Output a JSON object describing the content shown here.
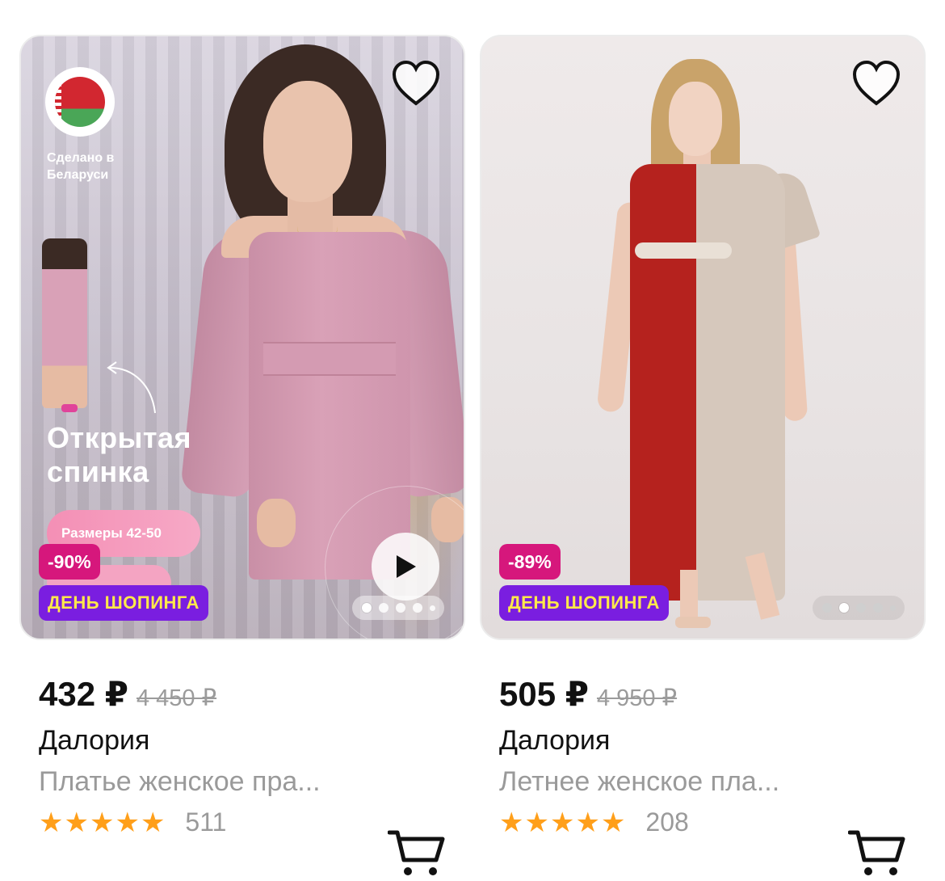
{
  "products": [
    {
      "promo_title": "Открытая спинка",
      "made_in_text": "Сделано в Беларуси",
      "sizes_label": "Размеры 42-50",
      "discount": "-90%",
      "sale_label": "ДЕНЬ ШОПИНГА",
      "price": "432 ₽",
      "old_price": "4 450 ₽",
      "brand": "Далория",
      "title": "Платье женское пра...",
      "rating_stars": 5,
      "reviews": "511",
      "carousel_active": 0,
      "has_video": true
    },
    {
      "discount": "-89%",
      "sale_label": "ДЕНЬ ШОПИНГА",
      "price": "505 ₽",
      "old_price": "4 950 ₽",
      "brand": "Далория",
      "title": "Летнее женское пла...",
      "rating_stars": 5,
      "reviews": "208",
      "carousel_active": 1,
      "has_video": false
    }
  ],
  "colors": {
    "discount_bg": "#d6177c",
    "sale_bg": "#7a1ee0",
    "sale_text": "#ffe94a",
    "star": "#ff9f1a"
  },
  "icons": {
    "favorite": "heart-outline-icon",
    "cart": "cart-icon",
    "play": "play-icon",
    "star": "star-icon"
  }
}
